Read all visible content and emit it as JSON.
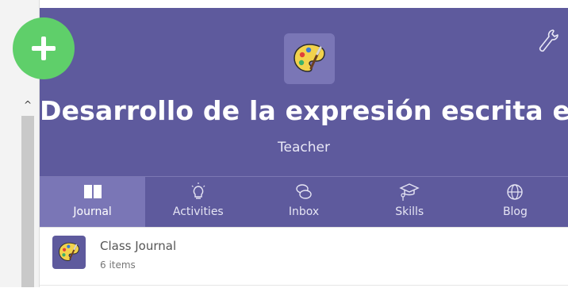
{
  "header": {
    "title": "Desarrollo de la expresión escrita e...",
    "subtitle": "Teacher",
    "background": "#5e5a9d",
    "settings_icon": "wrench-icon",
    "class_icon": "palette-icon"
  },
  "add_button": {
    "icon": "plus-icon",
    "color": "#5fcf6a"
  },
  "tabs": [
    {
      "label": "Journal",
      "icon": "book-icon",
      "active": true
    },
    {
      "label": "Activities",
      "icon": "lightbulb-icon",
      "active": false
    },
    {
      "label": "Inbox",
      "icon": "chat-bubbles-icon",
      "active": false
    },
    {
      "label": "Skills",
      "icon": "graduation-cap-icon",
      "active": false
    },
    {
      "label": "Blog",
      "icon": "globe-icon",
      "active": false
    }
  ],
  "journal": {
    "items": [
      {
        "title": "Class Journal",
        "count": "6 items",
        "icon": "palette-icon"
      }
    ]
  },
  "scrollbar": {
    "up_arrow": "^"
  }
}
